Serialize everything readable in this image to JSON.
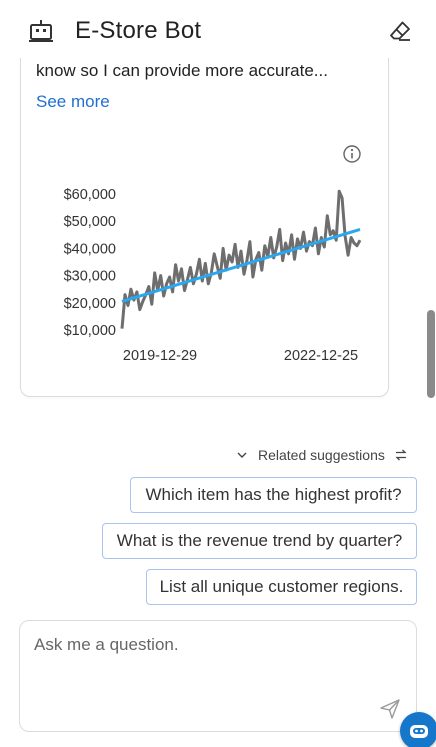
{
  "header": {
    "title": "E-Store Bot",
    "left_icon": "robot-icon",
    "right_icon": "eraser-icon"
  },
  "message": {
    "text": "know so I can provide more accurate...",
    "see_more_label": "See more",
    "info_icon": "info-icon"
  },
  "chart_data": {
    "type": "line",
    "title": "",
    "xlabel": "",
    "ylabel": "",
    "x_tick_labels": [
      "2019-12-29",
      "2022-12-25"
    ],
    "y_tick_labels": [
      "$60,000",
      "$50,000",
      "$40,000",
      "$30,000",
      "$20,000",
      "$10,000"
    ],
    "ylim": [
      10000,
      62000
    ],
    "grid": false,
    "series": [
      {
        "style": "data",
        "color": "#6e6e6e",
        "x": [
          "2019-12-29",
          "2020-01-12",
          "2020-01-26",
          "2020-02-09",
          "2020-02-23",
          "2020-03-08",
          "2020-03-22",
          "2020-04-05",
          "2020-04-19",
          "2020-05-03",
          "2020-05-17",
          "2020-05-31",
          "2020-06-14",
          "2020-06-28",
          "2020-07-12",
          "2020-07-26",
          "2020-08-09",
          "2020-08-23",
          "2020-09-06",
          "2020-09-20",
          "2020-10-04",
          "2020-10-18",
          "2020-11-01",
          "2020-11-15",
          "2020-11-29",
          "2020-12-13",
          "2020-12-27",
          "2021-01-10",
          "2021-01-24",
          "2021-02-07",
          "2021-02-21",
          "2021-03-07",
          "2021-03-21",
          "2021-04-04",
          "2021-04-18",
          "2021-05-02",
          "2021-05-16",
          "2021-05-30",
          "2021-06-13",
          "2021-06-27",
          "2021-07-11",
          "2021-07-25",
          "2021-08-08",
          "2021-08-22",
          "2021-09-05",
          "2021-09-19",
          "2021-10-03",
          "2021-10-17",
          "2021-10-31",
          "2021-11-14",
          "2021-11-28",
          "2021-12-12",
          "2021-12-26",
          "2022-01-09",
          "2022-01-23",
          "2022-02-06",
          "2022-02-20",
          "2022-03-06",
          "2022-03-20",
          "2022-04-03",
          "2022-04-17",
          "2022-05-01",
          "2022-05-15",
          "2022-05-29",
          "2022-06-12",
          "2022-06-26",
          "2022-07-10",
          "2022-07-24",
          "2022-08-07",
          "2022-08-21",
          "2022-09-04",
          "2022-09-18",
          "2022-10-02",
          "2022-10-16",
          "2022-10-30",
          "2022-11-13",
          "2022-11-27",
          "2022-12-11",
          "2022-12-25",
          "2023-01-08",
          "2023-01-22"
        ],
        "values": [
          10500,
          23000,
          19000,
          25000,
          21000,
          24000,
          17500,
          20500,
          23000,
          26000,
          19500,
          31000,
          24500,
          30000,
          22500,
          27000,
          29500,
          24000,
          34000,
          28000,
          32500,
          24500,
          28500,
          33000,
          27000,
          30500,
          36000,
          28000,
          34500,
          27000,
          31000,
          38000,
          33500,
          29000,
          40000,
          32000,
          37500,
          35000,
          41500,
          33000,
          39000,
          30500,
          35500,
          42500,
          29500,
          36000,
          38500,
          32000,
          41000,
          37000,
          44000,
          36500,
          40500,
          47000,
          35500,
          42000,
          38000,
          45000,
          36000,
          43500,
          40000,
          46000,
          39000,
          42500,
          41000,
          47500,
          38000,
          44000,
          40500,
          52000,
          45000,
          46500,
          43000,
          61000,
          58500,
          44500,
          37500,
          44000,
          42000,
          41000,
          43000
        ]
      },
      {
        "style": "trend",
        "color": "#2aa7ee",
        "x": [
          "2019-12-29",
          "2023-01-22"
        ],
        "values": [
          20500,
          47000
        ]
      }
    ]
  },
  "suggestions": {
    "header_label": "Related suggestions",
    "chevron_icon": "chevron-down-icon",
    "swap_icon": "swap-icon",
    "items": [
      "Which item has the highest profit?",
      "What is the revenue trend by quarter?",
      "List all unique customer regions."
    ]
  },
  "input": {
    "placeholder": "Ask me a question.",
    "value": "",
    "send_icon": "send-icon"
  },
  "fab": {
    "icon": "bot-launcher-icon",
    "color": "#1676c9"
  }
}
